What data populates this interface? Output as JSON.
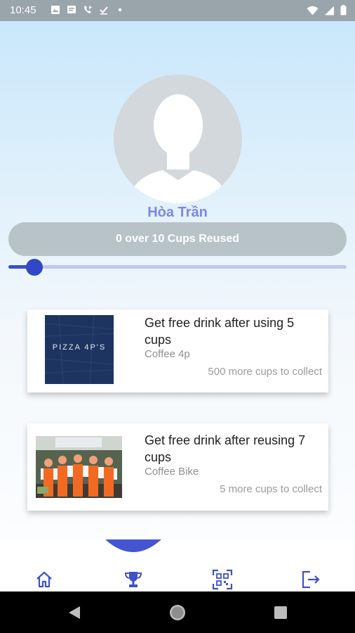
{
  "status_bar": {
    "time": "10:45",
    "left_icons": [
      "image-icon",
      "message-icon",
      "call-forward-icon",
      "download-done-icon",
      "dot-icon"
    ],
    "right_icons": [
      "wifi-icon",
      "signal-icon",
      "battery-icon"
    ]
  },
  "profile": {
    "avatar_icon": "person-silhouette-icon",
    "name": "Hòa Trần"
  },
  "progress": {
    "label": "0 over 10 Cups Reused",
    "value": 0,
    "max": 10
  },
  "rewards": [
    {
      "title": "Get free drink after using 5 cups",
      "shop": "Coffee 4p",
      "remaining": "500 more cups to collect",
      "image_text": "PIZZA 4P'S"
    },
    {
      "title": "Get free drink after reusing 7 cups",
      "shop": "Coffee Bike",
      "remaining": "5 more cups to collect",
      "image_text": ""
    }
  ],
  "bottom_nav": {
    "items": [
      "home-icon",
      "trophy-icon",
      "qr-scan-icon",
      "logout-icon"
    ],
    "active": "home-icon",
    "accent": "#3f51c7"
  },
  "system_nav": [
    "back-icon",
    "home-circle-icon",
    "recents-icon"
  ]
}
